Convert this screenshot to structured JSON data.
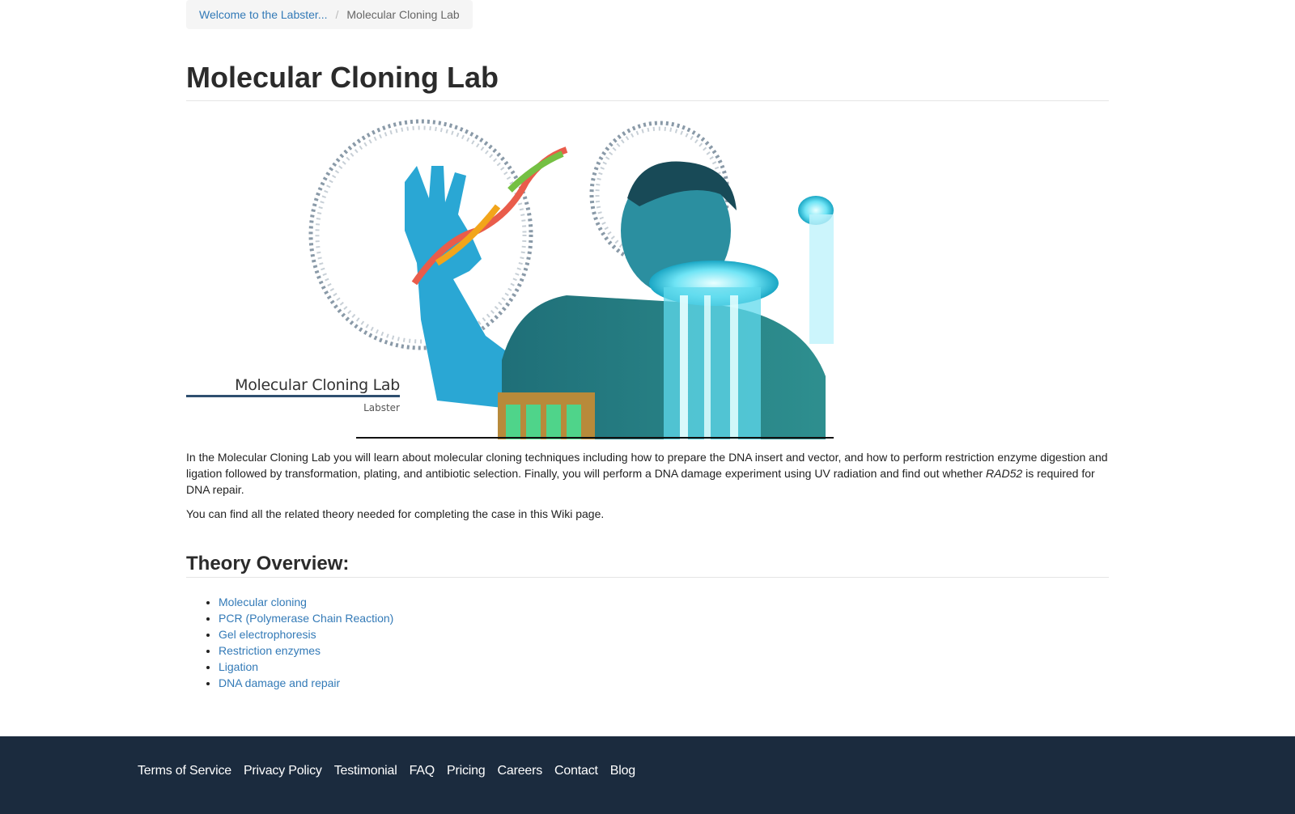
{
  "breadcrumb": {
    "home_label": "Welcome to the Labster...",
    "separator": "/",
    "current_label": "Molecular Cloning Lab"
  },
  "page": {
    "title": "Molecular Cloning Lab"
  },
  "hero": {
    "caption_title": "Molecular Cloning Lab",
    "caption_subtitle": "Labster"
  },
  "intro": {
    "paragraph_1_before": "In the Molecular Cloning Lab you will learn about molecular cloning techniques including how to prepare the DNA insert and vector, and how to perform restriction enzyme digestion and ligation followed by transformation, plating, and antibiotic selection. Finally, you will perform a DNA damage experiment using UV radiation and find out whether ",
    "paragraph_1_italic": "RAD52",
    "paragraph_1_after": " is required for DNA repair.",
    "paragraph_2": "You can find all the related theory needed for completing the case in this Wiki page."
  },
  "theory": {
    "heading": "Theory Overview:",
    "items": [
      {
        "label": "Molecular cloning"
      },
      {
        "label": "PCR (Polymerase Chain Reaction)"
      },
      {
        "label": "Gel electrophoresis"
      },
      {
        "label": "Restriction enzymes"
      },
      {
        "label": "Ligation"
      },
      {
        "label": "DNA damage and repair"
      }
    ]
  },
  "footer": {
    "links": [
      {
        "label": "Terms of Service"
      },
      {
        "label": "Privacy Policy"
      },
      {
        "label": "Testimonial"
      },
      {
        "label": "FAQ"
      },
      {
        "label": "Pricing"
      },
      {
        "label": "Careers"
      },
      {
        "label": "Contact"
      },
      {
        "label": "Blog"
      }
    ]
  },
  "colors": {
    "link": "#337ab7",
    "footer_bg": "#1b2b3e",
    "breadcrumb_bg": "#f5f5f5"
  }
}
